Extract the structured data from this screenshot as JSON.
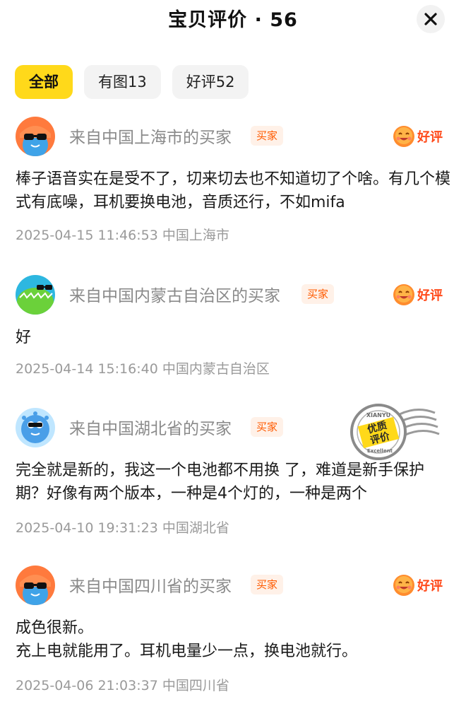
{
  "header": {
    "title": "宝贝评价 · 56"
  },
  "tabs": [
    {
      "label": "全部"
    },
    {
      "label": "有图13"
    },
    {
      "label": "好评52"
    }
  ],
  "rating_label": "好评",
  "buyer_tag": "买家",
  "stamp": {
    "top_text": "XIANYU",
    "line1": "优质",
    "line2": "评价",
    "bottom_text": "Excellent"
  },
  "reviews": [
    {
      "buyer": "来自中国上海市的买家",
      "content": "棒子语音实在是受不了，切来切去也不知道切了个啥。有几个模式有底噪，耳机要换电池，音质还行，不如mifa",
      "time": "2025-04-15 11:46:53",
      "location": "中国上海市"
    },
    {
      "buyer": "来自中国内蒙古自治区的买家",
      "content": "好",
      "time": "2025-04-14 15:16:40",
      "location": "中国内蒙古自治区"
    },
    {
      "buyer": "来自中国湖北省的买家",
      "content": "完全就是新的，我这一个电池都不用换 了，难道是新手保护期？好像有两个版本，一种是4个灯的，一种是两个",
      "time": "2025-04-10 19:31:23",
      "location": "中国湖北省"
    },
    {
      "buyer": "来自中国四川省的买家",
      "content": "成色很新。\n充上电就能用了。耳机电量少一点，换电池就行。",
      "time": "2025-04-06 21:03:37",
      "location": "中国四川省"
    }
  ],
  "colors": {
    "accent_yellow": "#ffd91a",
    "rating_orange": "#ff4a1a",
    "tag_bg": "#fff1e8",
    "tag_text": "#ff5a00",
    "meta_gray": "#9a9a9a"
  }
}
